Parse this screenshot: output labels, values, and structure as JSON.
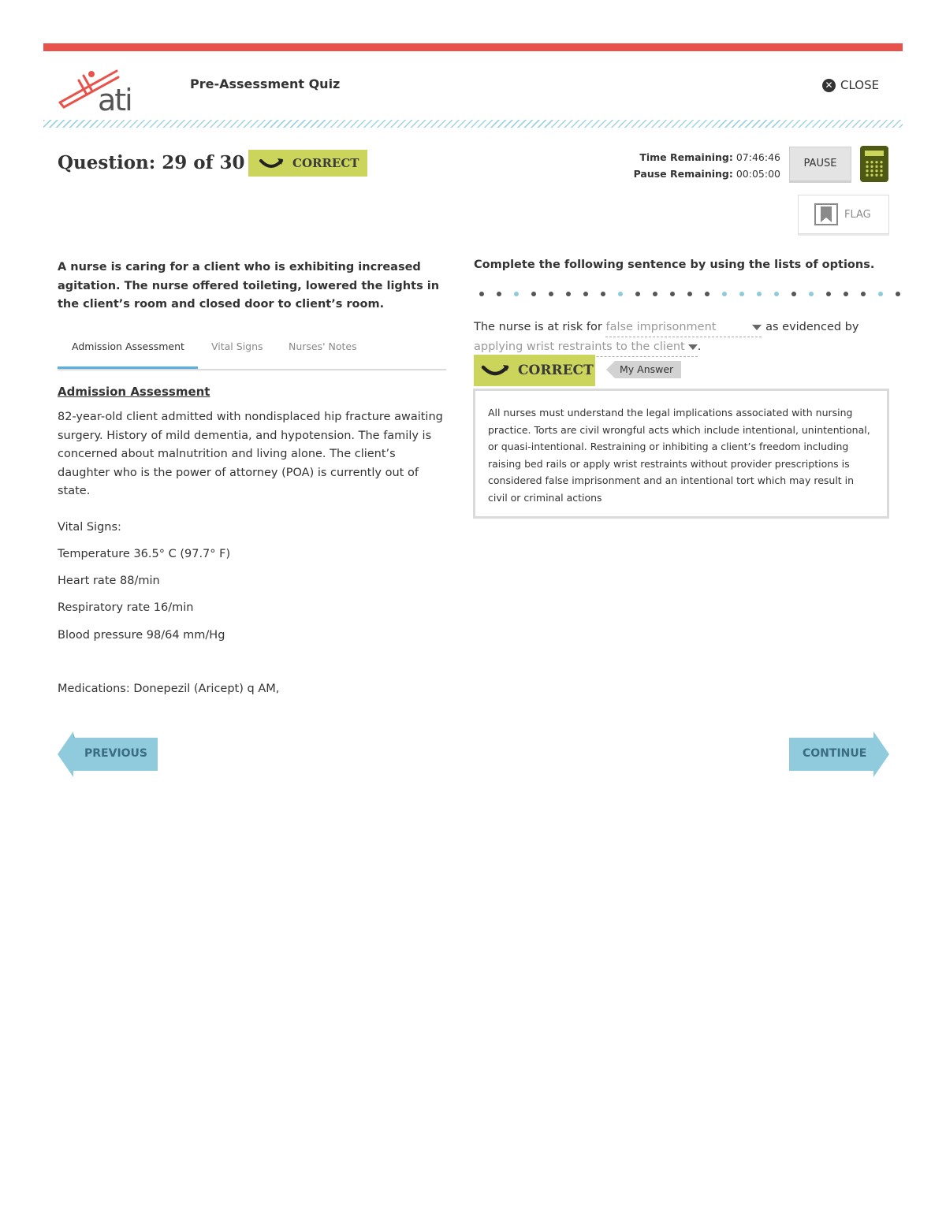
{
  "header": {
    "brand": "ati",
    "quiz_title": "Pre-Assessment Quiz",
    "close_label": "CLOSE"
  },
  "status": {
    "question_label": "Question: 29 of 30",
    "result_label": "CORRECT",
    "time_remaining_label": "Time Remaining:",
    "time_remaining_value": "07:46:46",
    "pause_remaining_label": "Pause Remaining:",
    "pause_remaining_value": "00:05:00",
    "pause_button": "PAUSE",
    "flag_button": "FLAG"
  },
  "stem": "A nurse is caring for a client who is exhibiting increased agitation. The nurse offered toileting, lowered the lights in the client’s room and closed door to client’s room.",
  "tabs": [
    "Admission Assessment",
    "Vital Signs",
    "Nurses' Notes"
  ],
  "admission": {
    "title": "Admission Assessment",
    "body": "82-year-old client admitted with nondisplaced hip fracture awaiting surgery.  History of mild dementia, and hypotension. The family is concerned about malnutrition and living alone. The client’s daughter who is the power of attorney (POA) is currently out of state.",
    "vitals_heading": "Vital Signs:",
    "vitals": [
      "Temperature 36.5° C (97.7° F)",
      "Heart rate 88/min",
      "Respiratory rate 16/min",
      "Blood pressure 98/64 mm/Hg"
    ],
    "medications": "Medications:  Donepezil (Aricept) q AM,"
  },
  "question": {
    "prompt": "Complete the following sentence by using the lists of options.",
    "sentence_part1": "The nurse is at risk for",
    "dropdown1": "false imprisonment",
    "sentence_part2": "as evidenced by",
    "dropdown2": "applying wrist restraints to the client",
    "sentence_end": ".",
    "result_label": "CORRECT",
    "my_answer_label": "My Answer",
    "rationale": "All nurses must understand the legal implications associated with nursing practice.  Torts are civil wrongful acts which include intentional, unintentional, or quasi-intentional. Restraining or inhibiting a client’s freedom including raising bed rails or apply wrist restraints without provider prescriptions is considered false imprisonment and an intentional tort which may result in civil or criminal actions"
  },
  "nav": {
    "previous": "PREVIOUS",
    "continue": "CONTINUE"
  },
  "colors": {
    "accent_red": "#e8524a",
    "correct_green": "#cbd45b",
    "nav_blue": "#8fcbdc",
    "calculator": "#4e5a13"
  },
  "progress_dots": [
    "#555",
    "#555",
    "#8fcbdc",
    "#555",
    "#555",
    "#555",
    "#555",
    "#555",
    "#8fcbdc",
    "#555",
    "#555",
    "#555",
    "#555",
    "#555",
    "#8fcbdc",
    "#8fcbdc",
    "#8fcbdc",
    "#8fcbdc",
    "#555",
    "#8fcbdc",
    "#555",
    "#555",
    "#555",
    "#8fcbdc",
    "#555"
  ]
}
